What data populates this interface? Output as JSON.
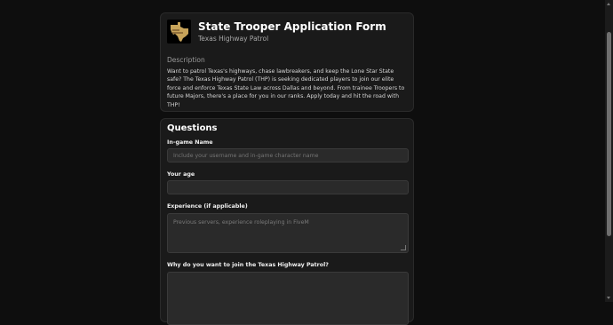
{
  "header": {
    "title": "State Trooper Application Form",
    "subtitle": "Texas Highway Patrol",
    "logo_icon": "texas-state-logo"
  },
  "description": {
    "heading": "Description",
    "text": "Want to patrol Texas's highways, chase lawbreakers, and keep the Lone Star State safe? The Texas Highway Patrol (THP) is seeking dedicated players to join our elite force and enforce Texas State Law across Dallas and beyond. From trainee Troopers to future Majors, there's a place for you in our ranks. Apply today and hit the road with THP!"
  },
  "questions": {
    "heading": "Questions",
    "items": [
      {
        "label": "In-game Name",
        "placeholder": "Include your username and in-game character name",
        "type": "text"
      },
      {
        "label": "Your age",
        "placeholder": "",
        "type": "text"
      },
      {
        "label": "Experience (if applicable)",
        "placeholder": "Previous servers, experience roleplaying in FiveM",
        "type": "textarea"
      },
      {
        "label": "Why do you want to join the Texas Highway Patrol?",
        "placeholder": "",
        "type": "textarea"
      }
    ]
  },
  "colors": {
    "background": "#0e0e0e",
    "card": "#1a1a1a",
    "input": "#2a2a2a",
    "logo_gold": "#c7a35a"
  }
}
